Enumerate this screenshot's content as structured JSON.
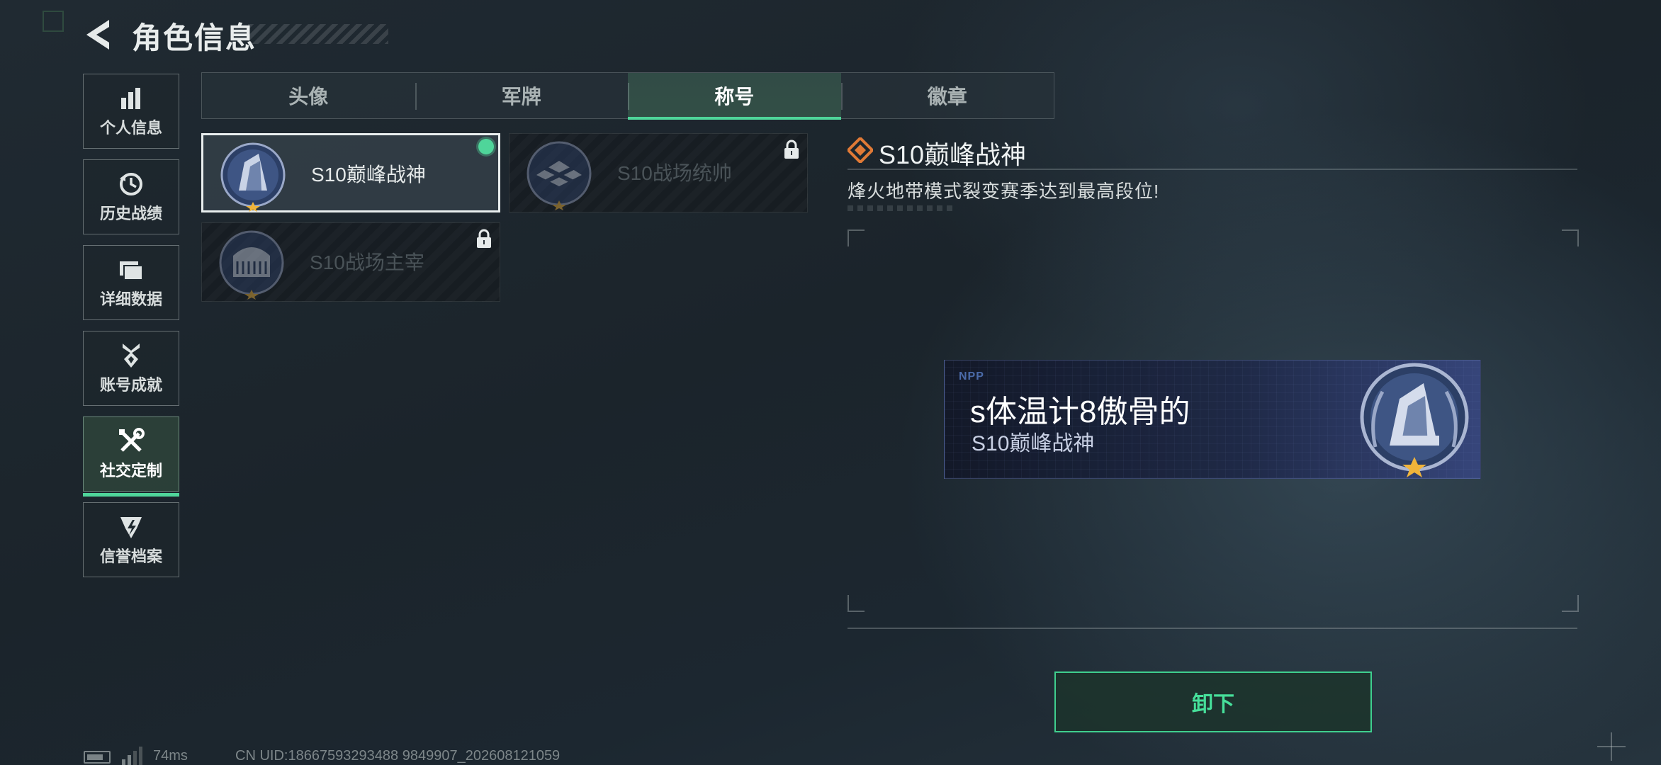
{
  "header": {
    "title": "角色信息",
    "back_icon": "back-arrow-icon"
  },
  "sidebar": {
    "items": [
      {
        "label": "个人信息",
        "icon": "bar-chart-icon",
        "active": false
      },
      {
        "label": "历史战绩",
        "icon": "history-clock-icon",
        "active": false
      },
      {
        "label": "详细数据",
        "icon": "folder-data-icon",
        "active": false
      },
      {
        "label": "账号成就",
        "icon": "achievement-medal-icon",
        "active": false
      },
      {
        "label": "社交定制",
        "icon": "tools-icon",
        "active": true
      },
      {
        "label": "信誉档案",
        "icon": "credit-shield-icon",
        "active": false
      }
    ]
  },
  "tabs": [
    {
      "label": "头像",
      "active": false
    },
    {
      "label": "军牌",
      "active": false
    },
    {
      "label": "称号",
      "active": true
    },
    {
      "label": "徽章",
      "active": false
    }
  ],
  "titles": [
    {
      "name": "S10巅峰战神",
      "locked": false,
      "selected": true,
      "equipped": true
    },
    {
      "name": "S10战场统帅",
      "locked": true,
      "selected": false,
      "equipped": false
    },
    {
      "name": "S10战场主宰",
      "locked": true,
      "selected": false,
      "equipped": false
    }
  ],
  "detail": {
    "title": "S10巅峰战神",
    "description": "烽火地带模式裂变赛季达到最高段位!"
  },
  "banner": {
    "tag": "NPP",
    "player_name": "s体温计8傲骨的",
    "title_text": "S10巅峰战神"
  },
  "actions": {
    "unequip_label": "卸下"
  },
  "status": {
    "ping": "74ms",
    "uid": "CN UID:18667593293488 9849907_202608121059"
  },
  "colors": {
    "accent": "#4fd59a",
    "detail_icon": "#e07a36"
  }
}
